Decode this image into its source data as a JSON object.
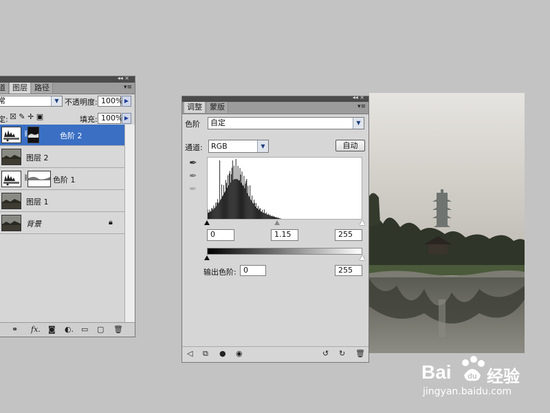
{
  "layers_panel": {
    "tabs": [
      {
        "label": "道"
      },
      {
        "label": "图层"
      },
      {
        "label": "路径"
      }
    ],
    "blend_mode": "常",
    "opacity_label": "不透明度:",
    "opacity_value": "100%",
    "lock_label": "定:",
    "fill_label": "填充:",
    "fill_value": "100%",
    "layers": [
      {
        "name": "色阶 2",
        "selected": true
      },
      {
        "name": "图层 2",
        "selected": false
      },
      {
        "name": "色阶 1",
        "selected": false
      },
      {
        "name": "图层 1",
        "selected": false
      },
      {
        "name": "背景",
        "selected": false
      }
    ]
  },
  "adjustments_panel": {
    "tabs": [
      {
        "label": "调整"
      },
      {
        "label": "蒙版"
      }
    ],
    "preset_label": "色阶",
    "preset_value": "自定",
    "channel_label": "通道:",
    "channel_value": "RGB",
    "auto_label": "自动",
    "input_black": "0",
    "input_gamma": "1.15",
    "input_white": "255",
    "output_label": "输出色阶:",
    "output_black": "0",
    "output_white": "255"
  },
  "watermark": {
    "brand": "Bai",
    "brand2": "经验",
    "url": "jingyan.baidu.com"
  },
  "icons": [
    "eyedropper-black-icon",
    "eyedropper-gray-icon",
    "eyedropper-white-icon",
    "link-icon",
    "fx-icon",
    "mask-icon",
    "adjustment-icon",
    "folder-icon",
    "new-layer-icon",
    "trash-icon",
    "lock-icon",
    "chain-icon"
  ]
}
